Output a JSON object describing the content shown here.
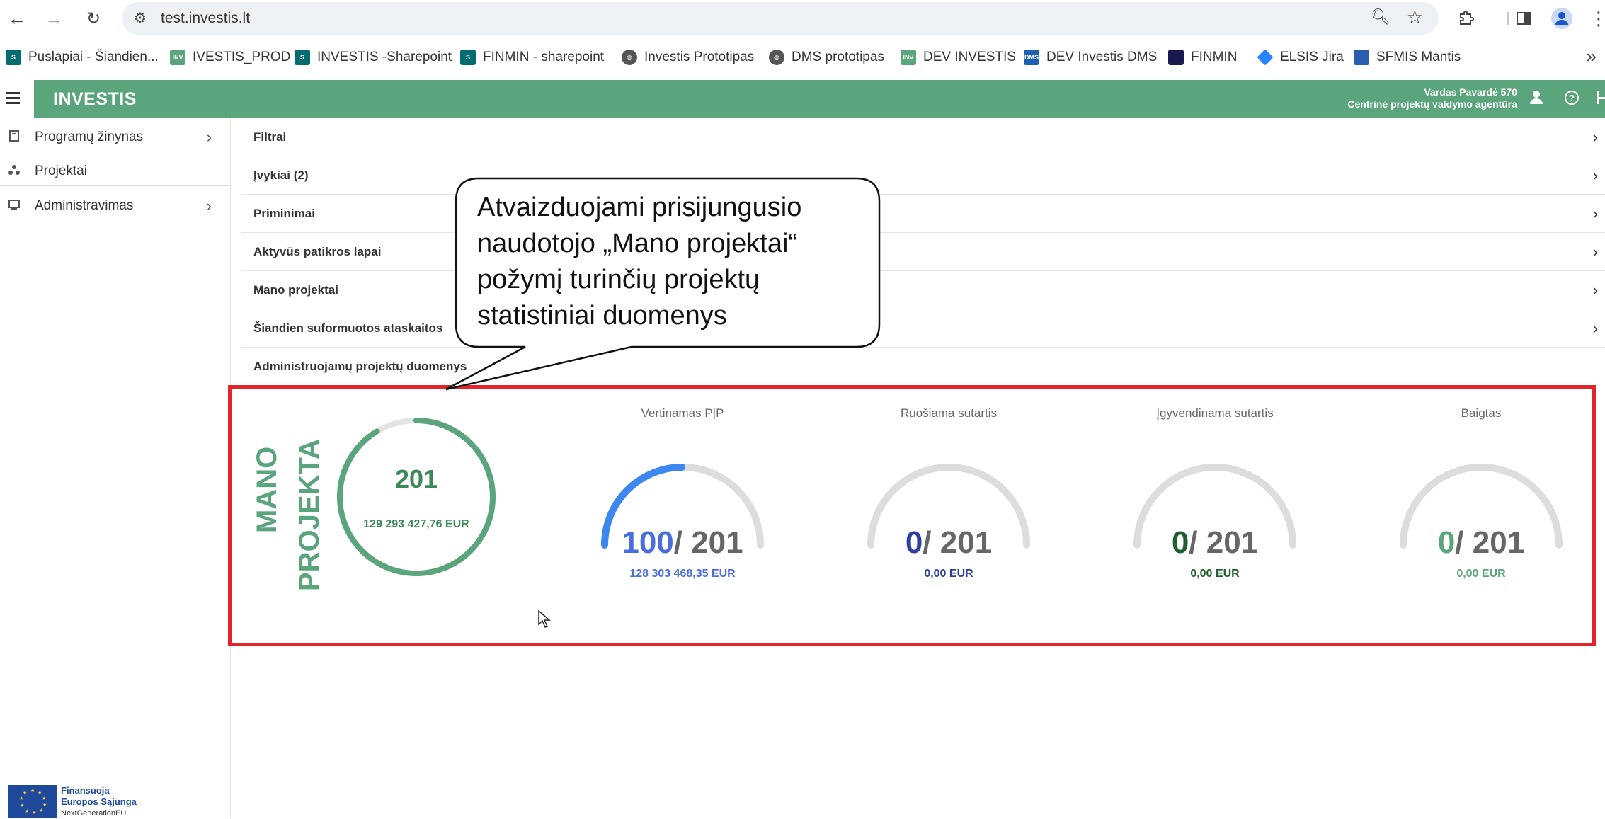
{
  "browser": {
    "url": "test.investis.lt",
    "bookmarks": [
      {
        "label": "Puslapiai - Šiandien...",
        "icon": "sharepoint-icon",
        "color": "#036c70"
      },
      {
        "label": "IVESTIS_PROD",
        "icon": "inv-icon",
        "color": "#5aa57c"
      },
      {
        "label": "INVESTIS -Sharepoint",
        "icon": "sharepoint-icon",
        "color": "#036c70"
      },
      {
        "label": "FINMIN - sharepoint",
        "icon": "sharepoint-icon",
        "color": "#036c70"
      },
      {
        "label": "Investis Prototipas",
        "icon": "globe-icon",
        "color": "#555555"
      },
      {
        "label": "DMS prototipas",
        "icon": "globe-icon",
        "color": "#555555"
      },
      {
        "label": "DEV INVESTIS",
        "icon": "inv-icon",
        "color": "#5aa57c"
      },
      {
        "label": "DEV Investis DMS",
        "icon": "dms-icon",
        "color": "#1f5fb5"
      },
      {
        "label": "FINMIN",
        "icon": "finmin-icon",
        "color": "#1a1a4e"
      },
      {
        "label": "ELSIS Jira",
        "icon": "jira-icon",
        "color": "#2684ff"
      },
      {
        "label": "SFMIS Mantis",
        "icon": "mantis-icon",
        "color": "#2a5db0"
      }
    ],
    "bookmark_icon_text": {
      "inv": "INV",
      "dms": "DMS"
    }
  },
  "app": {
    "logo": "INVESTIS",
    "user_name": "Vardas Pavardė 570",
    "user_org": "Centrinė projektų valdymo agentūra",
    "brand_color": "#5aa57c"
  },
  "sidebar": {
    "items": [
      {
        "label": "Programų žinynas",
        "icon": "book-icon"
      },
      {
        "label": "Projektai",
        "icon": "projects-icon"
      },
      {
        "label": "Administravimas",
        "icon": "admin-icon"
      }
    ],
    "eu": {
      "line1": "Finansuoja",
      "line2": "Europos Sąjunga",
      "line3": "NextGenerationEU"
    }
  },
  "accordion": [
    "Filtrai",
    "Įvykiai (2)",
    "Priminimai",
    "Aktyvūs patikros lapai",
    "Mano projektai",
    "Šiandien suformuotos ataskaitos",
    "Administruojamų projektų duomenys"
  ],
  "stats": {
    "title_line1": "MANO",
    "title_line2": "PROJEKTAI",
    "total_count": "201",
    "total_sum": "129 293 427,76 EUR",
    "gauges": [
      {
        "title": "Vertinamas P|P",
        "value": "100",
        "total": "/ 201",
        "fraction": 0.4975,
        "sum": "128 303 468,35 EUR",
        "color": "#4a6ee0",
        "arc_color": "#3d87f0"
      },
      {
        "title": "Ruošiama sutartis",
        "value": "0",
        "total": "/ 201",
        "fraction": 0,
        "sum": "0,00 EUR",
        "color": "#2e3fa0",
        "arc_color": "#3d87f0"
      },
      {
        "title": "Įgyvendinama sutartis",
        "value": "0",
        "total": "/ 201",
        "fraction": 0,
        "sum": "0,00 EUR",
        "color": "#1f5e2e",
        "arc_color": "#3d87f0"
      },
      {
        "title": "Baigtas",
        "value": "0",
        "total": "/ 201",
        "fraction": 0,
        "sum": "0,00 EUR",
        "color": "#5aa57c",
        "arc_color": "#3d87f0"
      }
    ]
  },
  "callout": {
    "text": "Atvaizduojami prisijungusio naudotojo „Mano projektai“ požymį turinčių projektų statistiniai duomenys"
  }
}
